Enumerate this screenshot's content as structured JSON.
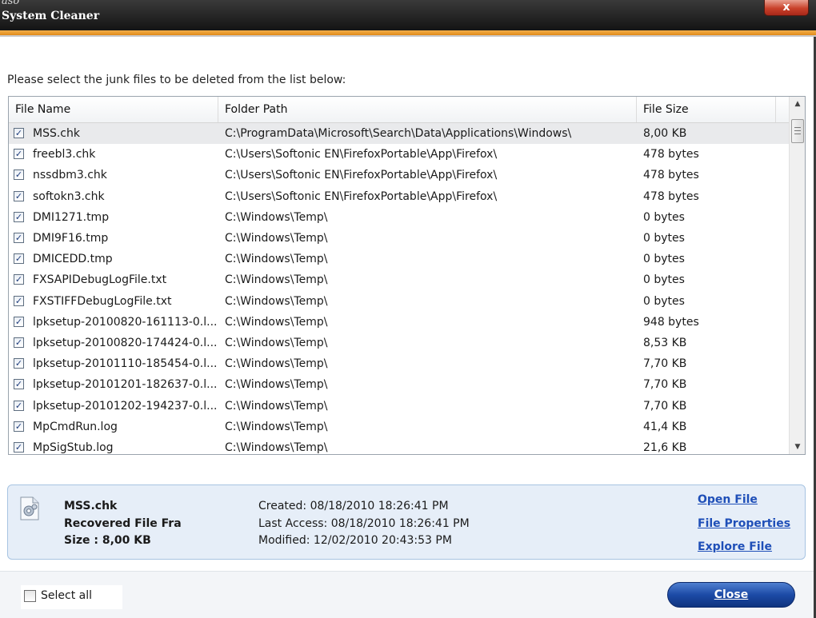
{
  "window": {
    "brand": "aso",
    "title": "System Cleaner",
    "close_glyph": "x"
  },
  "instruction": "Please select the junk files to be deleted from the list below:",
  "list": {
    "columns": [
      "File Name",
      "Folder Path",
      "File Size"
    ],
    "rows": [
      {
        "checked": true,
        "name": "MSS.chk",
        "path": "C:\\ProgramData\\Microsoft\\Search\\Data\\Applications\\Windows\\",
        "size": "8,00 KB",
        "selected": true
      },
      {
        "checked": true,
        "name": "freebl3.chk",
        "path": "C:\\Users\\Softonic EN\\FirefoxPortable\\App\\Firefox\\",
        "size": "478 bytes"
      },
      {
        "checked": true,
        "name": "nssdbm3.chk",
        "path": "C:\\Users\\Softonic EN\\FirefoxPortable\\App\\Firefox\\",
        "size": "478 bytes"
      },
      {
        "checked": true,
        "name": "softokn3.chk",
        "path": "C:\\Users\\Softonic EN\\FirefoxPortable\\App\\Firefox\\",
        "size": "478 bytes"
      },
      {
        "checked": true,
        "name": "DMI1271.tmp",
        "path": "C:\\Windows\\Temp\\",
        "size": "0 bytes"
      },
      {
        "checked": true,
        "name": "DMI9F16.tmp",
        "path": "C:\\Windows\\Temp\\",
        "size": "0 bytes"
      },
      {
        "checked": true,
        "name": "DMICEDD.tmp",
        "path": "C:\\Windows\\Temp\\",
        "size": "0 bytes"
      },
      {
        "checked": true,
        "name": "FXSAPIDebugLogFile.txt",
        "path": "C:\\Windows\\Temp\\",
        "size": "0 bytes"
      },
      {
        "checked": true,
        "name": "FXSTIFFDebugLogFile.txt",
        "path": "C:\\Windows\\Temp\\",
        "size": "0 bytes"
      },
      {
        "checked": true,
        "name": "lpksetup-20100820-161113-0.l...",
        "path": "C:\\Windows\\Temp\\",
        "size": "948 bytes"
      },
      {
        "checked": true,
        "name": "lpksetup-20100820-174424-0.l...",
        "path": "C:\\Windows\\Temp\\",
        "size": "8,53 KB"
      },
      {
        "checked": true,
        "name": "lpksetup-20101110-185454-0.l...",
        "path": "C:\\Windows\\Temp\\",
        "size": "7,70 KB"
      },
      {
        "checked": true,
        "name": "lpksetup-20101201-182637-0.l...",
        "path": "C:\\Windows\\Temp\\",
        "size": "7,70 KB"
      },
      {
        "checked": true,
        "name": "lpksetup-20101202-194237-0.l...",
        "path": "C:\\Windows\\Temp\\",
        "size": "7,70 KB"
      },
      {
        "checked": true,
        "name": "MpCmdRun.log",
        "path": "C:\\Windows\\Temp\\",
        "size": "41,4 KB"
      },
      {
        "checked": true,
        "name": "MpSigStub.log",
        "path": "C:\\Windows\\Temp\\",
        "size": "21,6 KB"
      }
    ]
  },
  "details": {
    "icon": "file-properties-icon",
    "name": "MSS.chk",
    "type": "Recovered File Fra",
    "size": "Size : 8,00 KB",
    "created": "Created: 08/18/2010 18:26:41 PM",
    "last_access": "Last Access: 08/18/2010 18:26:41 PM",
    "modified": "Modified: 12/02/2010 20:43:53 PM",
    "links": {
      "open": "Open File",
      "properties": "File Properties",
      "explore": "Explore File"
    }
  },
  "footer": {
    "select_all_label": "Select all",
    "select_all_checked": false,
    "close_label": "Close"
  },
  "colors": {
    "accent_orange": "#e08a1a",
    "title_bar": "#1a1a1a",
    "link_blue": "#1f4fb8",
    "button_blue": "#1c4aa6",
    "selected_row": "#e9eaec"
  }
}
